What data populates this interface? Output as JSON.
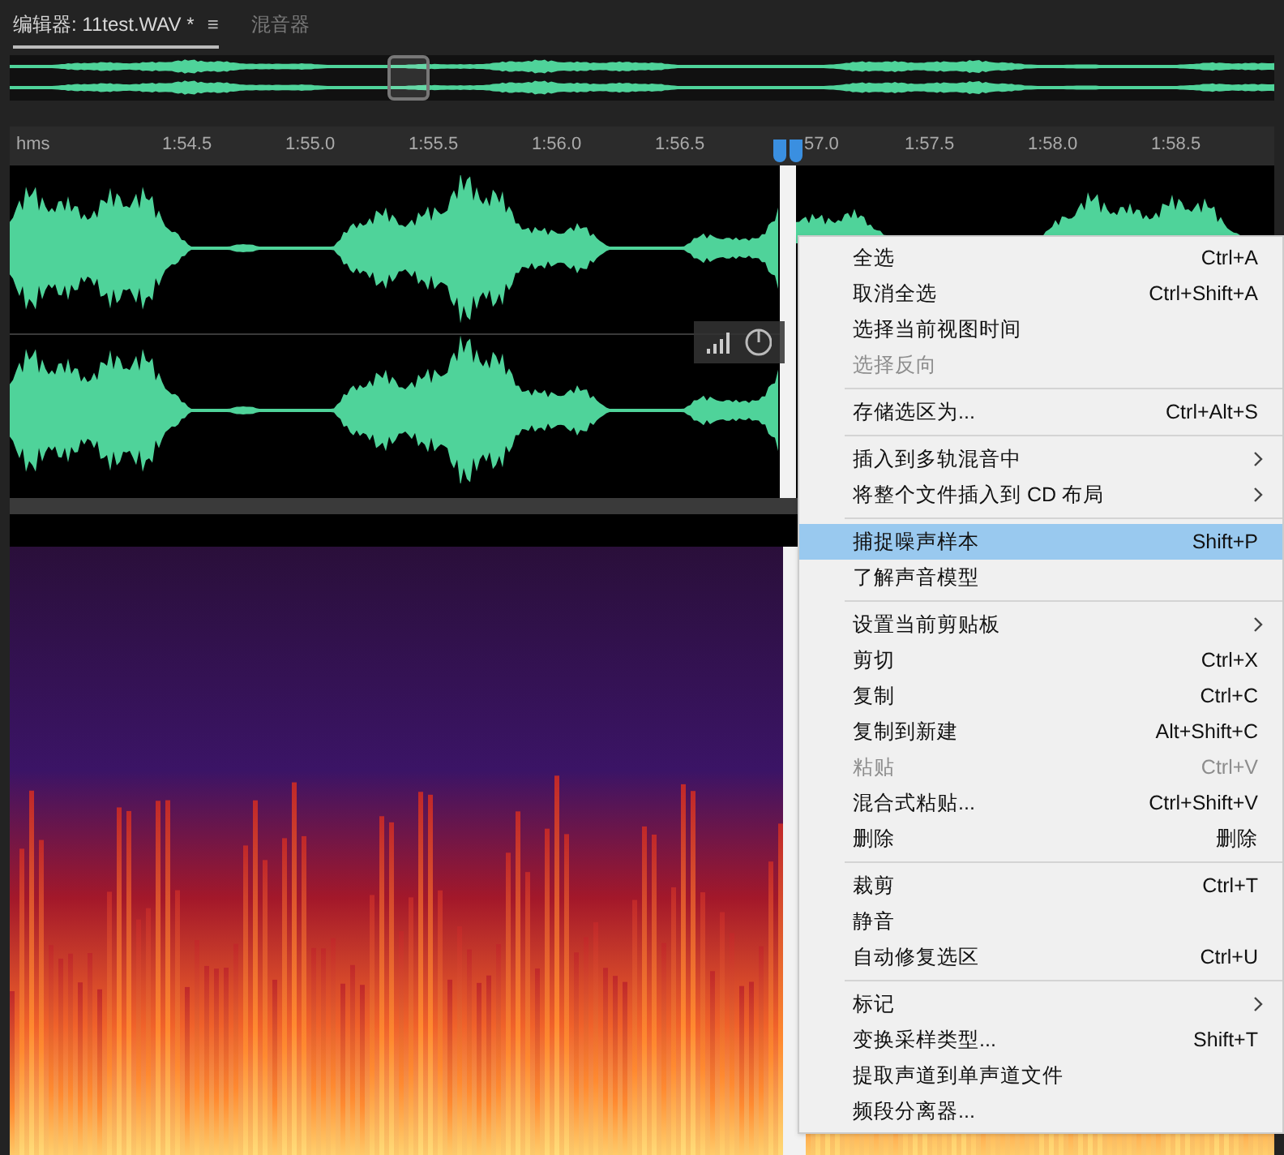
{
  "tabs": [
    {
      "label": "编辑器: 11test.WAV *",
      "selected": true,
      "menu_glyph": "≡"
    },
    {
      "label": "混音器",
      "selected": false
    }
  ],
  "ruler": {
    "unit": "hms",
    "labels": [
      "1:54.5",
      "1:55.0",
      "1:55.5",
      "1:56.0",
      "1:56.5",
      "57.0",
      "1:57.5",
      "1:58.0",
      "1:58.5"
    ]
  },
  "context_menu": {
    "groups": [
      [
        {
          "label": "全选",
          "shortcut": "Ctrl+A",
          "disabled": false,
          "submenu": false,
          "selected": false
        },
        {
          "label": "取消全选",
          "shortcut": "Ctrl+Shift+A",
          "disabled": false,
          "submenu": false,
          "selected": false
        },
        {
          "label": "选择当前视图时间",
          "disabled": false,
          "submenu": false,
          "selected": false
        },
        {
          "label": "选择反向",
          "disabled": true,
          "submenu": false,
          "selected": false
        }
      ],
      [
        {
          "label": "存储选区为...",
          "shortcut": "Ctrl+Alt+S",
          "disabled": false,
          "submenu": false,
          "selected": false
        }
      ],
      [
        {
          "label": "插入到多轨混音中",
          "disabled": false,
          "submenu": true,
          "selected": false
        },
        {
          "label": "将整个文件插入到 CD 布局",
          "disabled": false,
          "submenu": true,
          "selected": false
        }
      ],
      [
        {
          "label": "捕捉噪声样本",
          "shortcut": "Shift+P",
          "disabled": false,
          "submenu": false,
          "selected": true
        },
        {
          "label": "了解声音模型",
          "disabled": false,
          "submenu": false,
          "selected": false
        }
      ],
      [
        {
          "label": "设置当前剪贴板",
          "disabled": false,
          "submenu": true,
          "selected": false
        },
        {
          "label": "剪切",
          "shortcut": "Ctrl+X",
          "disabled": false,
          "submenu": false,
          "selected": false
        },
        {
          "label": "复制",
          "shortcut": "Ctrl+C",
          "disabled": false,
          "submenu": false,
          "selected": false
        },
        {
          "label": "复制到新建",
          "shortcut": "Alt+Shift+C",
          "disabled": false,
          "submenu": false,
          "selected": false
        },
        {
          "label": "粘贴",
          "shortcut": "Ctrl+V",
          "disabled": true,
          "submenu": false,
          "selected": false
        },
        {
          "label": "混合式粘贴...",
          "shortcut": "Ctrl+Shift+V",
          "disabled": false,
          "submenu": false,
          "selected": false
        },
        {
          "label": "删除",
          "shortcut": "删除",
          "disabled": false,
          "submenu": false,
          "selected": false
        }
      ],
      [
        {
          "label": "裁剪",
          "shortcut": "Ctrl+T",
          "disabled": false,
          "submenu": false,
          "selected": false
        },
        {
          "label": "静音",
          "disabled": false,
          "submenu": false,
          "selected": false
        },
        {
          "label": "自动修复选区",
          "shortcut": "Ctrl+U",
          "disabled": false,
          "submenu": false,
          "selected": false
        }
      ],
      [
        {
          "label": "标记",
          "disabled": false,
          "submenu": true,
          "selected": false
        },
        {
          "label": "变换采样类型...",
          "shortcut": "Shift+T",
          "disabled": false,
          "submenu": false,
          "selected": false
        },
        {
          "label": "提取声道到单声道文件",
          "disabled": false,
          "submenu": false,
          "selected": false
        },
        {
          "label": "频段分离器...",
          "disabled": false,
          "submenu": false,
          "selected": false
        }
      ]
    ]
  }
}
